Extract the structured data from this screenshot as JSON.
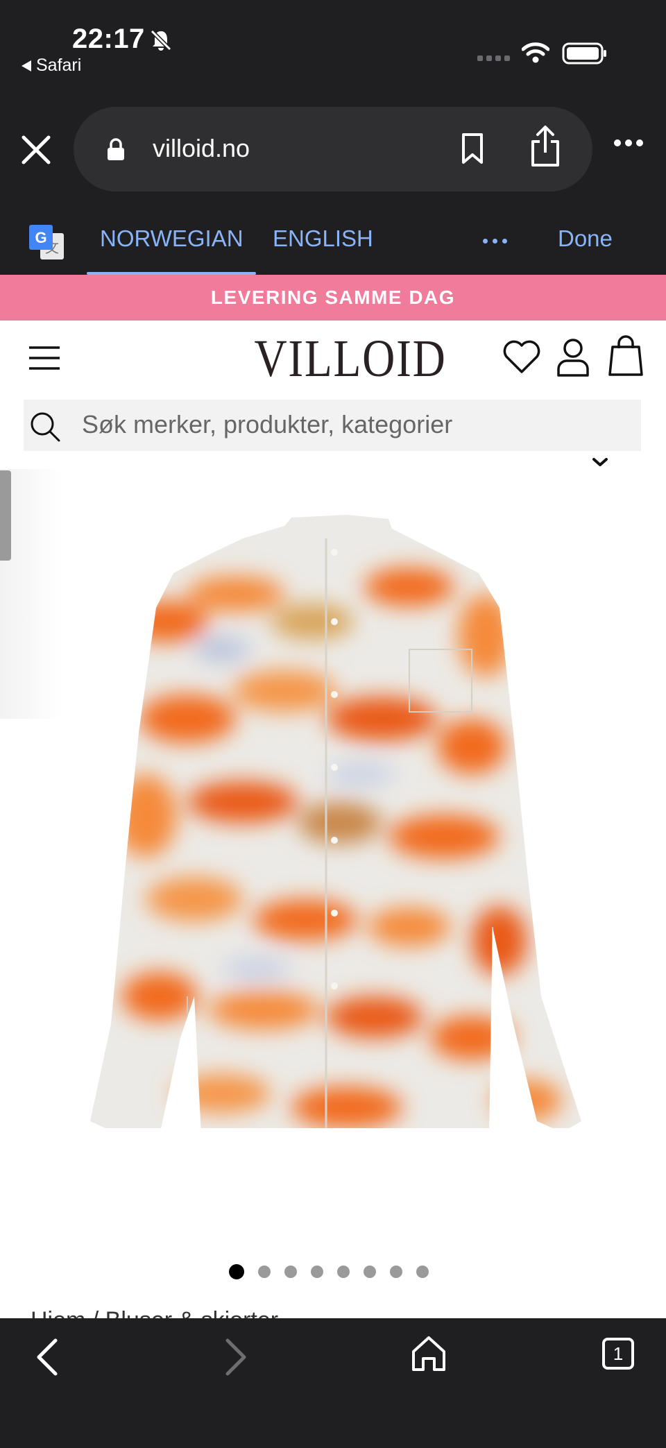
{
  "status_bar": {
    "time": "22:17",
    "back_app": "Safari",
    "icons": [
      "bell-off-icon",
      "signal-icon",
      "wifi-icon",
      "battery-icon"
    ]
  },
  "address_bar": {
    "url": "villoid.no",
    "icons": [
      "close-icon",
      "lock-icon",
      "bookmark-icon",
      "share-icon",
      "more-icon"
    ]
  },
  "translate_bar": {
    "languages": [
      "NORWEGIAN",
      "ENGLISH"
    ],
    "selected": "NORWEGIAN",
    "done_label": "Done",
    "accent_color": "#8ab4f8"
  },
  "site": {
    "promo_banner": "LEVERING SAMME DAG",
    "promo_color": "#f07b9b",
    "logo": "VILLOID",
    "search_placeholder": "Søk merker, produkter, kategorier",
    "header_icons": [
      "menu-icon",
      "heart-icon",
      "account-icon",
      "cart-icon"
    ],
    "carousel": {
      "total": 8,
      "active": 1
    },
    "breadcrumb": "Hjem / Bluser & skjorter"
  },
  "browser_toolbar": {
    "tab_count": "1",
    "icons": [
      "back-icon",
      "forward-icon",
      "home-icon",
      "tabs-icon"
    ]
  }
}
